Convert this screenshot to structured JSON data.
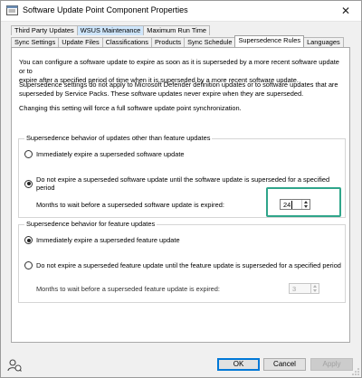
{
  "window": {
    "title": "Software Update Point Component Properties",
    "close_glyph": "✕",
    "icon": "app-properties-icon"
  },
  "tabs": {
    "row1": [
      {
        "label": "Third Party Updates",
        "state": "normal"
      },
      {
        "label": "WSUS Maintenance",
        "state": "highlight"
      },
      {
        "label": "Maximum Run Time",
        "state": "normal"
      }
    ],
    "row2": [
      {
        "label": "Sync Settings",
        "state": "normal"
      },
      {
        "label": "Update Files",
        "state": "normal"
      },
      {
        "label": "Classifications",
        "state": "normal"
      },
      {
        "label": "Products",
        "state": "normal"
      },
      {
        "label": "Sync Schedule",
        "state": "normal"
      },
      {
        "label": "Supersedence Rules",
        "state": "active"
      },
      {
        "label": "Languages",
        "state": "normal"
      }
    ]
  },
  "content": {
    "para1_line1": "You can configure a software update to expire as soon as it is superseded by a more recent software update or to",
    "para1_line2": "expire after a specified period of time when it is superseded by a more recent software update.",
    "para2_line1": "Supersedence settings do not apply to Microsoft Defender definition updates or to software updates that are",
    "para2_line2": "superseded by Service Packs. These software updates never expire when they are superseded.",
    "para3": "Changing this setting will force a full software update point synchronization."
  },
  "group1": {
    "legend": "Supersedence behavior of updates other than feature updates",
    "option1": "Immediately expire a superseded software update",
    "option2": "Do not expire a superseded software update until the software update is superseded for a specified period",
    "selected": 2,
    "months_label": "Months to wait before a superseded software update is expired:",
    "months_value": "24"
  },
  "group2": {
    "legend": "Supersedence behavior for feature updates",
    "option1": "Immediately expire a superseded feature update",
    "option2": "Do not expire a superseded feature update until the feature update is superseded for a specified period",
    "selected": 1,
    "months_label": "Months to wait before a superseded feature update is expired:",
    "months_value": "3"
  },
  "buttons": {
    "ok": "OK",
    "cancel": "Cancel",
    "apply": "Apply"
  },
  "footer_icon": "user-help-icon",
  "colors": {
    "highlight_box": "#2fa58a",
    "default_button_border": "#0078d7"
  }
}
